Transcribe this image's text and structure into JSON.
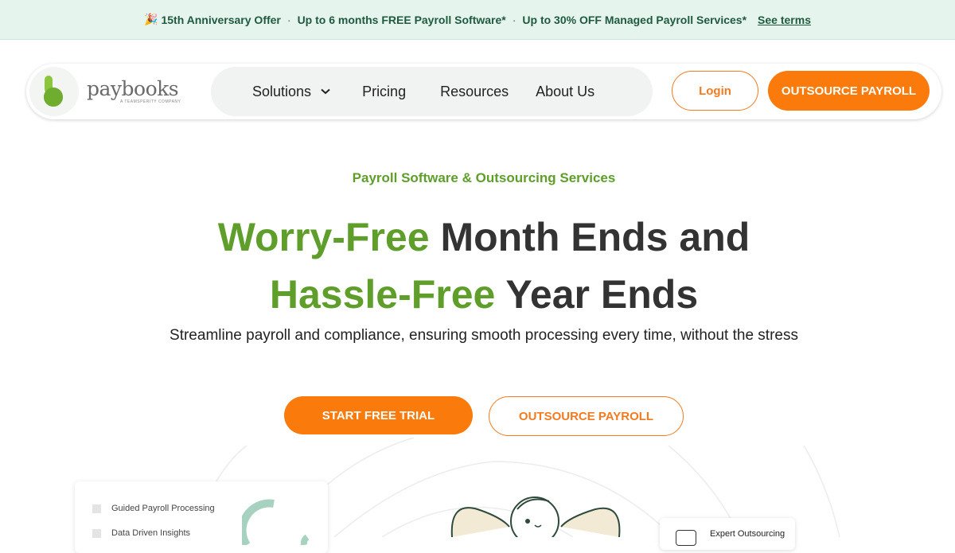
{
  "announcement": {
    "emoji": "🎉",
    "offer": "15th Anniversary Offer",
    "sep": "·",
    "payroll_software": "Up to 6 months FREE Payroll Software*",
    "managed_services": "Up to 30% OFF Managed Payroll Services*",
    "terms_link": "See terms"
  },
  "header": {
    "logo_name": "paybooks",
    "logo_tagline": "A TEAMSPERITY COMPANY",
    "nav": {
      "solutions": "Solutions",
      "pricing": "Pricing",
      "resources": "Resources",
      "about": "About Us"
    },
    "login_label": "Login",
    "outsource_label": "OUTSOURCE PAYROLL"
  },
  "hero": {
    "eyebrow": "Payroll Software & Outsourcing Services",
    "headline_green_1": "Worry-Free",
    "headline_rest_1": " Month Ends and",
    "headline_green_2": "Hassle-Free",
    "headline_rest_2": " Year Ends",
    "subhead": "Streamline payroll and compliance, ensuring smooth processing every time, without the stress",
    "cta_primary": "START FREE TRIAL",
    "cta_secondary": "OUTSOURCE PAYROLL"
  },
  "illustration": {
    "features": [
      "Guided Payroll Processing",
      "Data Driven Insights"
    ],
    "expert_label": "Expert Outsourcing"
  },
  "colors": {
    "brand_orange": "#fb7a0c",
    "brand_green": "#5f9e2a",
    "announce_bg": "#e6f4ee"
  }
}
